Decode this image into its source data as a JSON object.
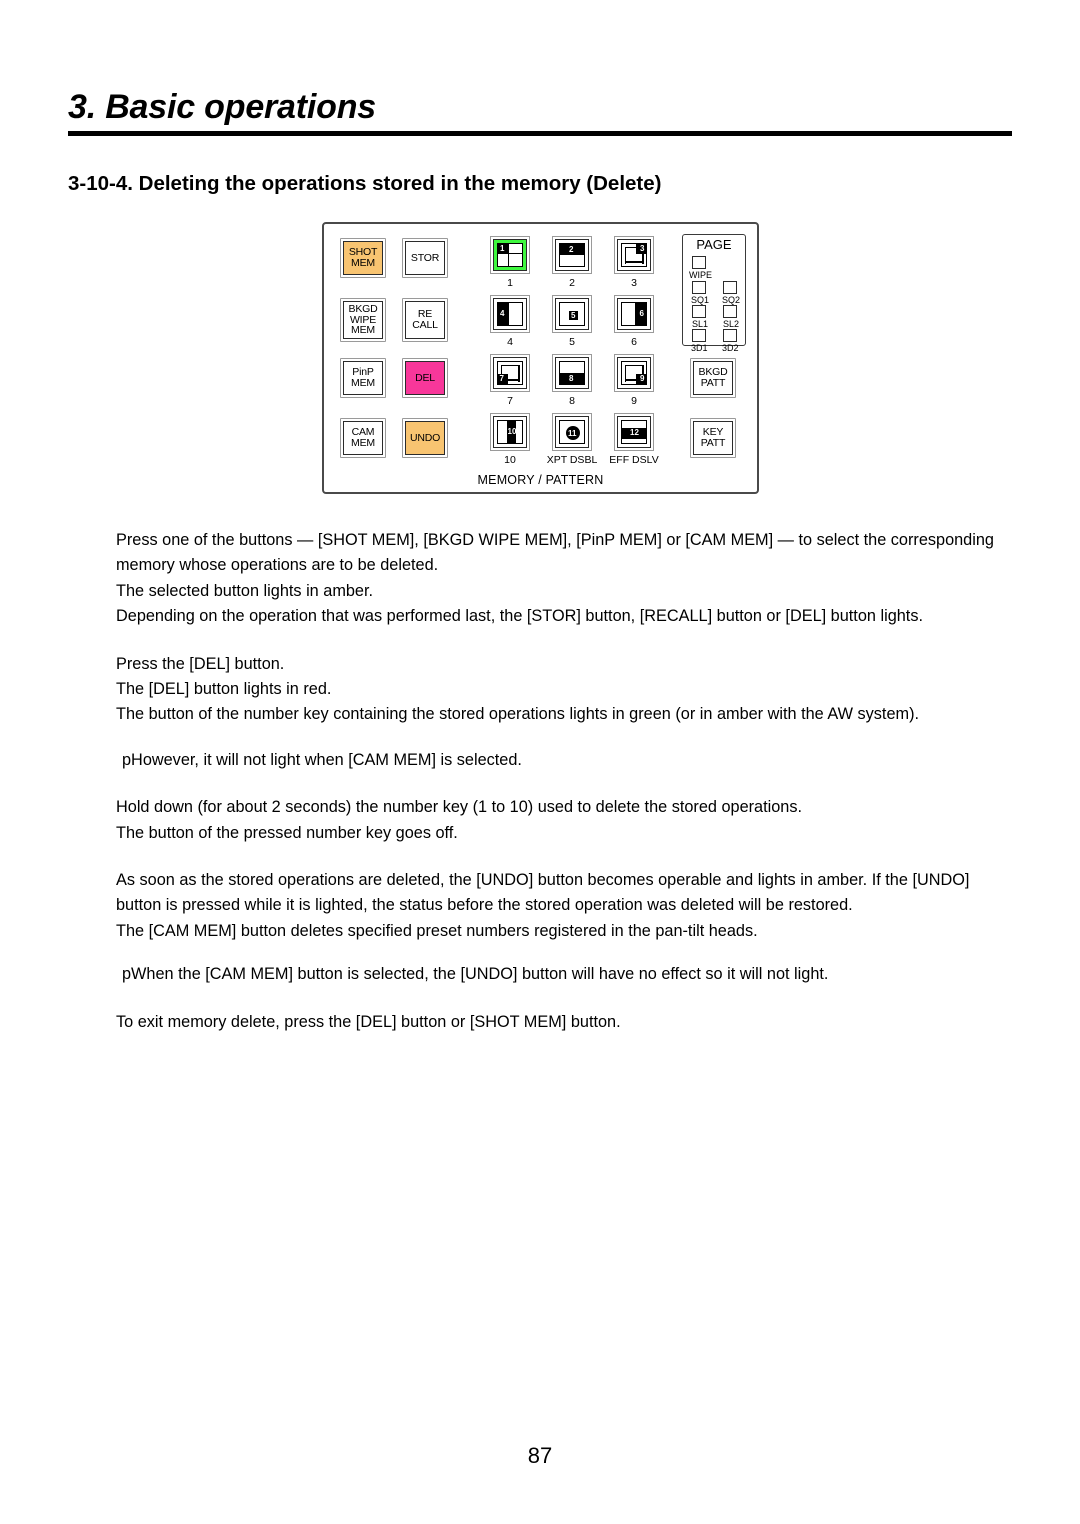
{
  "document": {
    "chapter_title": "3. Basic operations",
    "section_heading": "3-10-4. Deleting the operations stored in the memory (Delete)",
    "page_number": "87"
  },
  "colors": {
    "amber": "#f8c471",
    "magenta": "#f8379a",
    "lit_green": "#3ef73e",
    "button_outline": "#2b2b2b",
    "panel_border": "#4a4a4a"
  },
  "panel": {
    "caption": "MEMORY / PATTERN",
    "mem_buttons": [
      {
        "label": "SHOT\nMEM",
        "line1": "SHOT",
        "line2": "MEM",
        "state": "amber"
      },
      {
        "label": "BKGD WIPE MEM",
        "line1": "BKGD",
        "line2": "WIPE",
        "line3": "MEM",
        "state": "off"
      },
      {
        "label": "PinP MEM",
        "line1": "PinP",
        "line2": "MEM",
        "state": "off"
      },
      {
        "label": "CAM MEM",
        "line1": "CAM",
        "line2": "MEM",
        "state": "off"
      }
    ],
    "op_buttons": [
      {
        "label": "STOR",
        "line1": "STOR",
        "state": "off"
      },
      {
        "label": "RE CALL",
        "line1": "RE",
        "line2": "CALL",
        "state": "off"
      },
      {
        "label": "DEL",
        "line1": "DEL",
        "state": "magenta"
      },
      {
        "label": "UNDO",
        "line1": "UNDO",
        "state": "amber"
      }
    ],
    "number_keys": [
      {
        "number": "1",
        "caption": "1",
        "pattern": "corner-tl-square",
        "state": "lit"
      },
      {
        "number": "2",
        "caption": "2",
        "pattern": "band-top",
        "state": "off"
      },
      {
        "number": "3",
        "caption": "3",
        "pattern": "corner-tr-small",
        "state": "off"
      },
      {
        "number": "4",
        "caption": "4",
        "pattern": "band-left",
        "state": "off"
      },
      {
        "number": "5",
        "caption": "5",
        "pattern": "center-square",
        "state": "off"
      },
      {
        "number": "6",
        "caption": "6",
        "pattern": "band-right",
        "state": "off"
      },
      {
        "number": "7",
        "caption": "7",
        "pattern": "corner-bl-small",
        "state": "off"
      },
      {
        "number": "8",
        "caption": "8",
        "pattern": "band-bottom",
        "state": "off"
      },
      {
        "number": "9",
        "caption": "9",
        "pattern": "corner-br-small",
        "state": "off"
      },
      {
        "number": "10",
        "caption": "10",
        "pattern": "bar-vertical-center",
        "state": "off"
      },
      {
        "number": "11",
        "caption": "XPT DSBL",
        "pattern": "circle-center",
        "state": "off"
      },
      {
        "number": "12",
        "caption": "EFF DSLV",
        "pattern": "band-middle",
        "state": "off"
      }
    ],
    "page_group": {
      "title": "PAGE",
      "leds": [
        {
          "label": "WIPE"
        },
        {
          "label": "SQ1"
        },
        {
          "label": "SQ2"
        },
        {
          "label": "SL1"
        },
        {
          "label": "SL2"
        },
        {
          "label": "3D1"
        },
        {
          "label": "3D2"
        }
      ]
    },
    "patt_buttons": [
      {
        "label": "BKGD PATT",
        "line1": "BKGD",
        "line2": "PATT"
      },
      {
        "label": "KEY PATT",
        "line1": "KEY",
        "line2": "PATT"
      }
    ]
  },
  "body": {
    "p1": "Press one of the buttons — [SHOT MEM], [BKGD WIPE MEM], [PinP MEM] or [CAM MEM] — to select the corresponding memory whose operations are to be deleted.",
    "p2": "The selected button lights in amber.",
    "p3": "Depending on the operation that was performed last, the [STOR] button, [RECALL] button or [DEL] button lights.",
    "p4": "Press the [DEL] button.",
    "p5": "The [DEL] button lights in red.",
    "p6": "The button of the number key containing the stored operations lights in green (or in amber with the AW system).",
    "p7": "pHowever, it will not light when [CAM MEM] is selected.",
    "p8": "Hold down (for about 2 seconds) the number key (1 to 10) used to delete the stored operations.",
    "p9": "The button of the pressed number key goes off.",
    "p10": "As soon as the stored operations are deleted, the [UNDO] button becomes operable and lights in amber. If the [UNDO] button is pressed while it is lighted, the status before the stored operation was deleted will be restored.",
    "p11": "The [CAM MEM] button deletes specified preset numbers registered in the pan-tilt heads.",
    "p12": "pWhen the [CAM MEM] button is selected, the [UNDO] button will have no effect so it will not light.",
    "p13": "To exit memory delete, press the [DEL] button or [SHOT MEM] button."
  }
}
